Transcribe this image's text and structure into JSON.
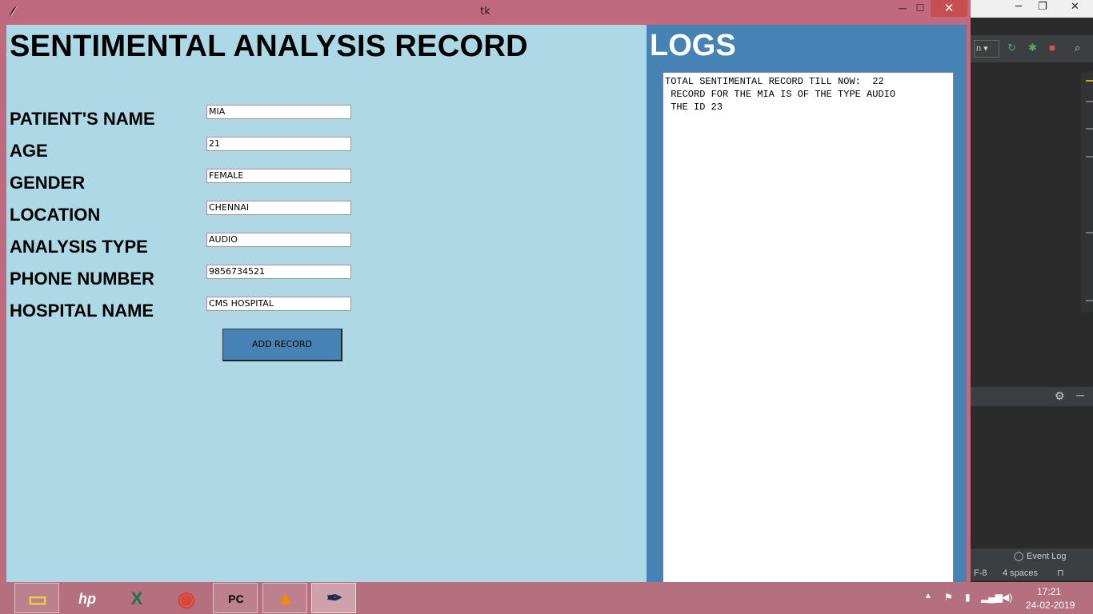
{
  "window": {
    "title": "tk",
    "minimize": "─",
    "maximize": "☐",
    "close": "✕"
  },
  "form": {
    "title": "SENTIMENTAL ANALYSIS RECORD",
    "fields": [
      {
        "label": "PATIENT'S NAME",
        "value": "MIA"
      },
      {
        "label": "AGE",
        "value": "21"
      },
      {
        "label": "GENDER",
        "value": "FEMALE"
      },
      {
        "label": "LOCATION",
        "value": "CHENNAI"
      },
      {
        "label": "ANALYSIS TYPE",
        "value": "AUDIO"
      },
      {
        "label": "PHONE NUMBER",
        "value": "9856734521"
      },
      {
        "label": "HOSPITAL NAME",
        "value": "CMS HOSPITAL"
      }
    ],
    "add_button": "ADD RECORD"
  },
  "logs": {
    "title": "LOGS",
    "lines": [
      "TOTAL SENTIMENTAL RECORD TILL NOW:  22",
      " RECORD FOR THE MIA IS OF THE TYPE AUDIO",
      " THE ID 23"
    ]
  },
  "ide": {
    "combo_text": "n",
    "event_log": "Event Log",
    "encoding": "F-8",
    "indent": "4 spaces"
  },
  "taskbar": {
    "apps": [
      {
        "name": "file-explorer-icon",
        "glyph": "▭"
      },
      {
        "name": "hp-icon",
        "glyph": "hp"
      },
      {
        "name": "excel-icon",
        "glyph": "X"
      },
      {
        "name": "chrome-icon",
        "glyph": "◉"
      },
      {
        "name": "pycharm-icon",
        "glyph": "PC"
      },
      {
        "name": "vlc-icon",
        "glyph": "▲"
      },
      {
        "name": "tk-feather-icon",
        "glyph": "✒"
      }
    ],
    "time": "17:21",
    "date": "24-02-2019"
  },
  "colors": {
    "form_bg": "#add8e6",
    "logs_bg": "#4682b4",
    "button_bg": "#4682b4",
    "titlebar": "#c16a7f",
    "close": "#c74f4f"
  }
}
